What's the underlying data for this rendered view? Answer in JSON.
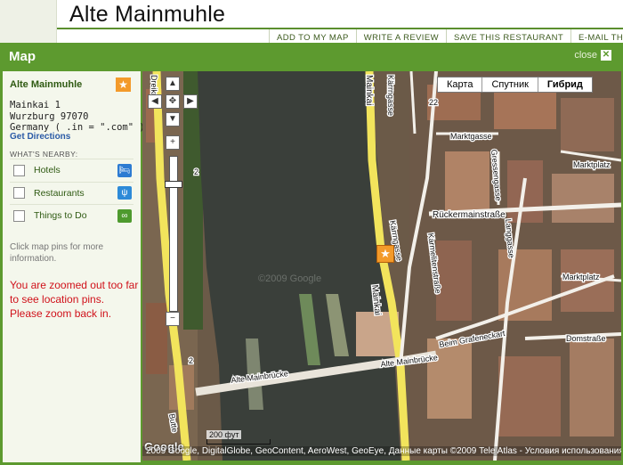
{
  "page": {
    "title": "Alte Mainmuhle",
    "actions": [
      "ADD TO MY MAP",
      "WRITE A REVIEW",
      "SAVE THIS RESTAURANT",
      "E-MAIL THIS"
    ]
  },
  "modal": {
    "title": "Map",
    "close_label": "close",
    "close_glyph": "✕"
  },
  "sidebar": {
    "place_name": "Alte Mainmuhle",
    "star_glyph": "★",
    "address_lines": [
      "Mainkai 1",
      "Wurzburg 97070",
      "Germany ( .in = \".com\" )"
    ],
    "directions": "Get Directions",
    "nearby_title": "WHAT'S NEARBY:",
    "nearby": [
      {
        "label": "Hotels",
        "icon": "bed-icon",
        "glyph": "🛏",
        "color": "#2d7bd2"
      },
      {
        "label": "Restaurants",
        "icon": "fork-knife-icon",
        "glyph": "ψ",
        "color": "#2d8ad8"
      },
      {
        "label": "Things to Do",
        "icon": "binoculars-icon",
        "glyph": "∞",
        "color": "#4e9a2e"
      }
    ],
    "hint": "Click map pins for more information.",
    "warning": "You are zoomed out too far to see location pins. Please zoom back in."
  },
  "map": {
    "types": [
      {
        "label": "Карта",
        "selected": false
      },
      {
        "label": "Спутник",
        "selected": false
      },
      {
        "label": "Гибрид",
        "selected": true
      }
    ],
    "pan": {
      "up": "▲",
      "left": "◀",
      "center": "✥",
      "right": "▶",
      "down": "▼"
    },
    "zoom": {
      "in": "+",
      "out": "−",
      "level_fraction": 0.16
    },
    "streets": {
      "dreikron": "Dreikr",
      "mainkai": "Mainkai",
      "kaerrngasse": "Kärrngasse",
      "kaerrngasse2": "Kärrngasse",
      "marktgasse": "Marktgasse",
      "marktplatz": "Marktplatz",
      "marktplatz2": "Marktplatz",
      "gressengasse": "Gressengasse",
      "rueckermain": "Rückermainstraße",
      "langgasse": "Langgasse",
      "karmeliten": "Karmelitenstraße",
      "grafeneckart": "Beim Grafeneckart",
      "domstrasse": "Domstraße",
      "altemain1": "Alte Mainbrücke",
      "altemain2": "Alte Mainbrücke",
      "butte": "Butte",
      "num22": "22",
      "num2": "2"
    },
    "watermark": "©2009 Google",
    "pin_glyph": "★",
    "scale_label": "200 фут",
    "google_logo": "Google",
    "attribution": "2009 Google, DigitalGlobe, GeoContent, AeroWest, GeoEye, Данные карты ©2009 Tele Atlas - Условия использования",
    "colors": {
      "road": "#f2e45c",
      "water": "#3a3f3a",
      "urban": "#6b5a48",
      "roof": "#9c6a4f",
      "greenery": "#3f5a2e"
    }
  }
}
